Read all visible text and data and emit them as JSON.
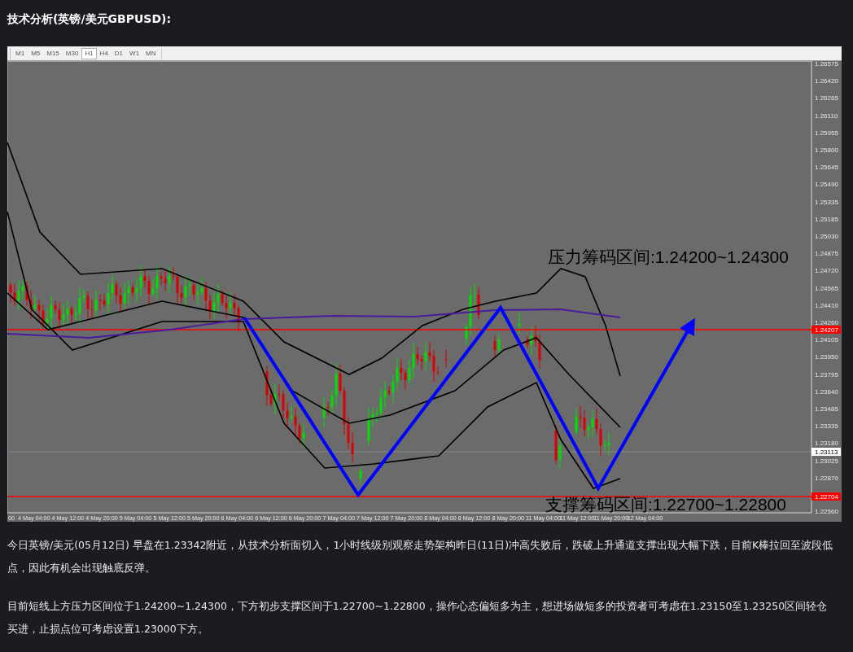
{
  "title": "技术分析(英镑/美元GBPUSD):",
  "chart": {
    "timeframes": [
      {
        "label": "M1",
        "selected": false
      },
      {
        "label": "M5",
        "selected": false
      },
      {
        "label": "M15",
        "selected": false
      },
      {
        "label": "M30",
        "selected": false
      },
      {
        "label": "H1",
        "selected": true
      },
      {
        "label": "H4",
        "selected": false
      },
      {
        "label": "D1",
        "selected": false
      },
      {
        "label": "W1",
        "selected": false
      },
      {
        "label": "MN",
        "selected": false
      }
    ],
    "y_ticks": [
      "1.26575",
      "1.26420",
      "1.26265",
      "1.26110",
      "1.25955",
      "1.25800",
      "1.25645",
      "1.25490",
      "1.25335",
      "1.25185",
      "1.25030",
      "1.24875",
      "1.24720",
      "1.24565",
      "1.24410",
      "1.24260",
      "1.24105",
      "1.23950",
      "1.23795",
      "1.23640",
      "1.23485",
      "1.23335",
      "1.23180",
      "1.23025",
      "1.22870",
      "1.22560"
    ],
    "x_ticks": [
      "00",
      "4 May 04:00",
      "4 May 12:00",
      "4 May 20:00",
      "5 May 04:00",
      "5 May 12:00",
      "5 May 20:00",
      "6 May 04:00",
      "6 May 12:00",
      "6 May 20:00",
      "7 May 04:00",
      "7 May 12:00",
      "7 May 20:00",
      "8 May 04:00",
      "8 May 12:00",
      "8 May 20:00",
      "11 May 04:00",
      "11 May 12:00",
      "11 May 20:00",
      "12 May 04:00"
    ],
    "price_lines": [
      {
        "label": "1.24207"
      },
      {
        "label": "1.22704"
      }
    ],
    "current_price": "1.23113",
    "annotations": [
      "压力筹码区间:1.24200~1.24300",
      "支撑筹码区间:1.22700~1.22800"
    ]
  },
  "paragraphs": [
    "今日英镑/美元(05月12日) 早盘在1.23342附近，从技术分析面切入，1小时线级别观察走势架构昨日(11日)冲高失败后，跌破上升通道支撑出现大幅下跌，目前K棒拉回至波段低点，因此有机会出现触底反弹。",
    "目前短线上方压力区间位于1.24200~1.24300，下方初步支撑区间于1.22700~1.22800，操作心态偏短多为主，想进场做短多的投资者可考虑在1.23150至1.23250区间轻仓买进，止损点位可考虑设置1.23000下方。"
  ]
}
